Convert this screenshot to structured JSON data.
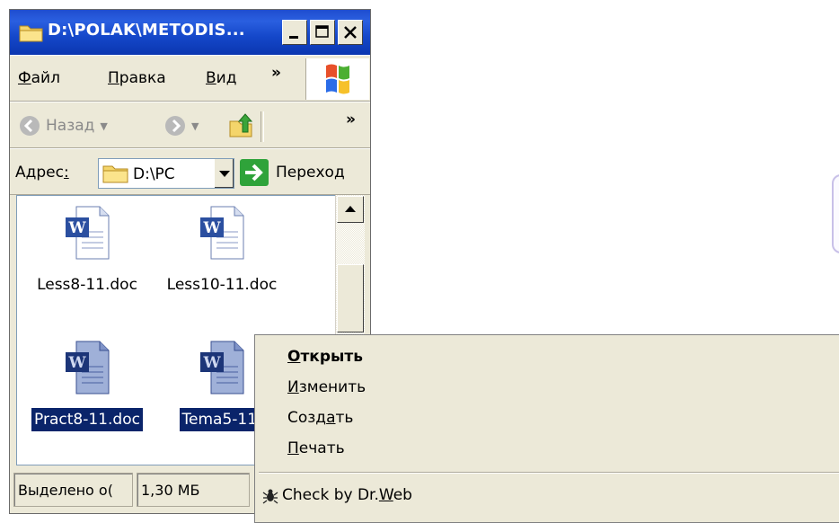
{
  "window": {
    "title": "D:\\POLAK\\METODIS...",
    "controls": {
      "minimize": "_",
      "maximize": "□",
      "close": "X"
    }
  },
  "menubar": {
    "items": [
      {
        "label": "Файл",
        "accel": "Ф",
        "rest": "айл"
      },
      {
        "label": "Правка",
        "accel": "П",
        "rest": "равка"
      },
      {
        "label": "Вид",
        "accel": "В",
        "rest": "ид"
      }
    ],
    "overflow": "»"
  },
  "toolbar": {
    "back_label": "Назад",
    "overflow": "»"
  },
  "address": {
    "label_main": "Адрес",
    "label_accel": ":",
    "value": "D:\\PC",
    "go_label": "Переход"
  },
  "files": [
    {
      "name": "Less8-11.doc",
      "selected": false
    },
    {
      "name": "Less10-11.doc",
      "selected": false
    },
    {
      "name": "Pract8-11.doc",
      "selected": true
    },
    {
      "name": "Tema5-11.",
      "selected": true
    }
  ],
  "statusbar": {
    "selection": "Выделено о(",
    "size": "1,30 МБ"
  },
  "context_menu": {
    "items": [
      {
        "pre": "",
        "accel": "О",
        "post": "ткрыть",
        "default": true
      },
      {
        "pre": "",
        "accel": "И",
        "post": "зменить",
        "default": false
      },
      {
        "pre": "Созд",
        "accel": "а",
        "post": "ть",
        "default": false
      },
      {
        "pre": "",
        "accel": "П",
        "post": "ечать",
        "default": false
      }
    ],
    "extension": {
      "pre": "Check by Dr.",
      "accel": "W",
      "post": "eb"
    }
  },
  "colors": {
    "titlebar": "#1447c9",
    "selection": "#0a246a",
    "face": "#ece9d8"
  }
}
